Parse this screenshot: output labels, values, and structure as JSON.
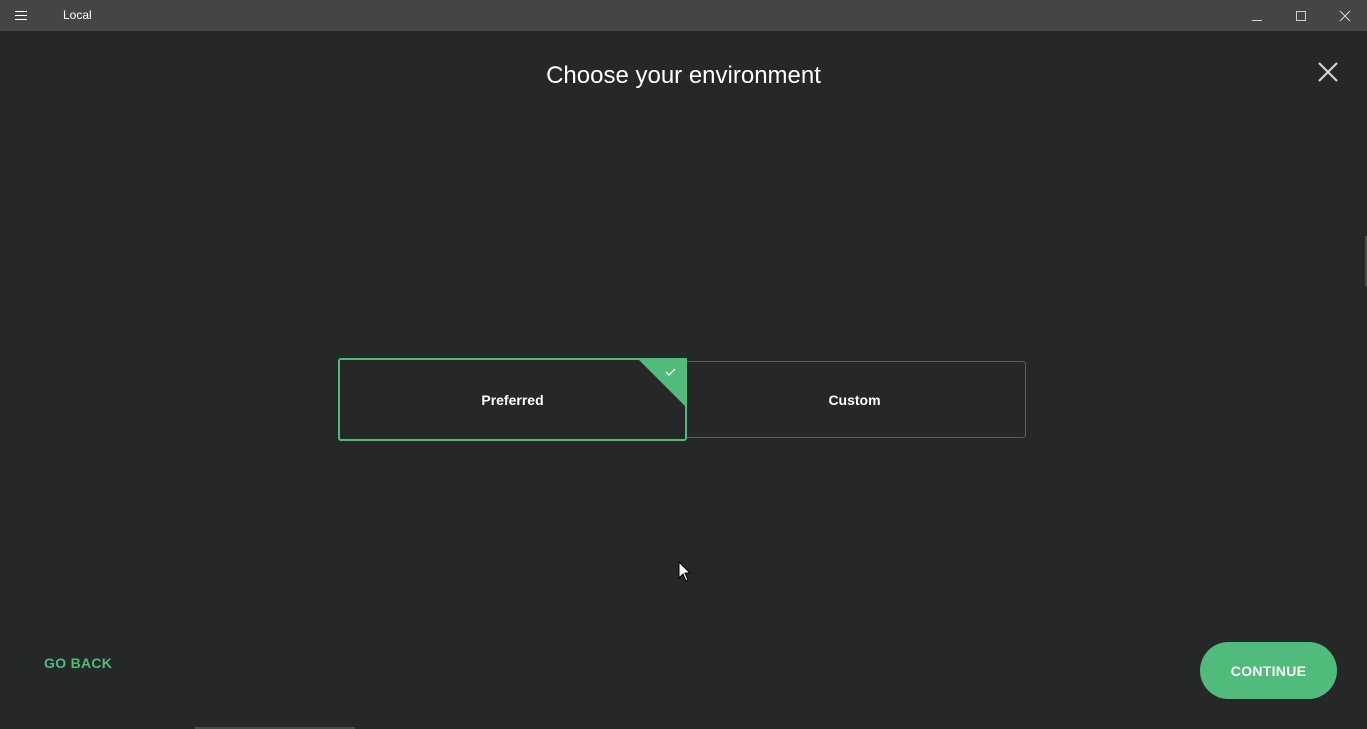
{
  "window": {
    "title": "Local",
    "menu_icon": "hamburger-icon",
    "controls": {
      "minimize_icon": "minimize-icon",
      "maximize_icon": "maximize-icon",
      "close_icon": "close-icon"
    }
  },
  "page": {
    "title": "Choose your environment",
    "close_icon": "close-icon"
  },
  "options": [
    {
      "label": "Preferred",
      "selected": true
    },
    {
      "label": "Custom",
      "selected": false
    }
  ],
  "footer": {
    "back_label": "GO BACK",
    "continue_label": "CONTINUE"
  },
  "colors": {
    "accent": "#51bb7b",
    "background": "#262727",
    "titlebar": "#454545",
    "text": "#ffffff",
    "card_border": "#5a5b5b"
  }
}
